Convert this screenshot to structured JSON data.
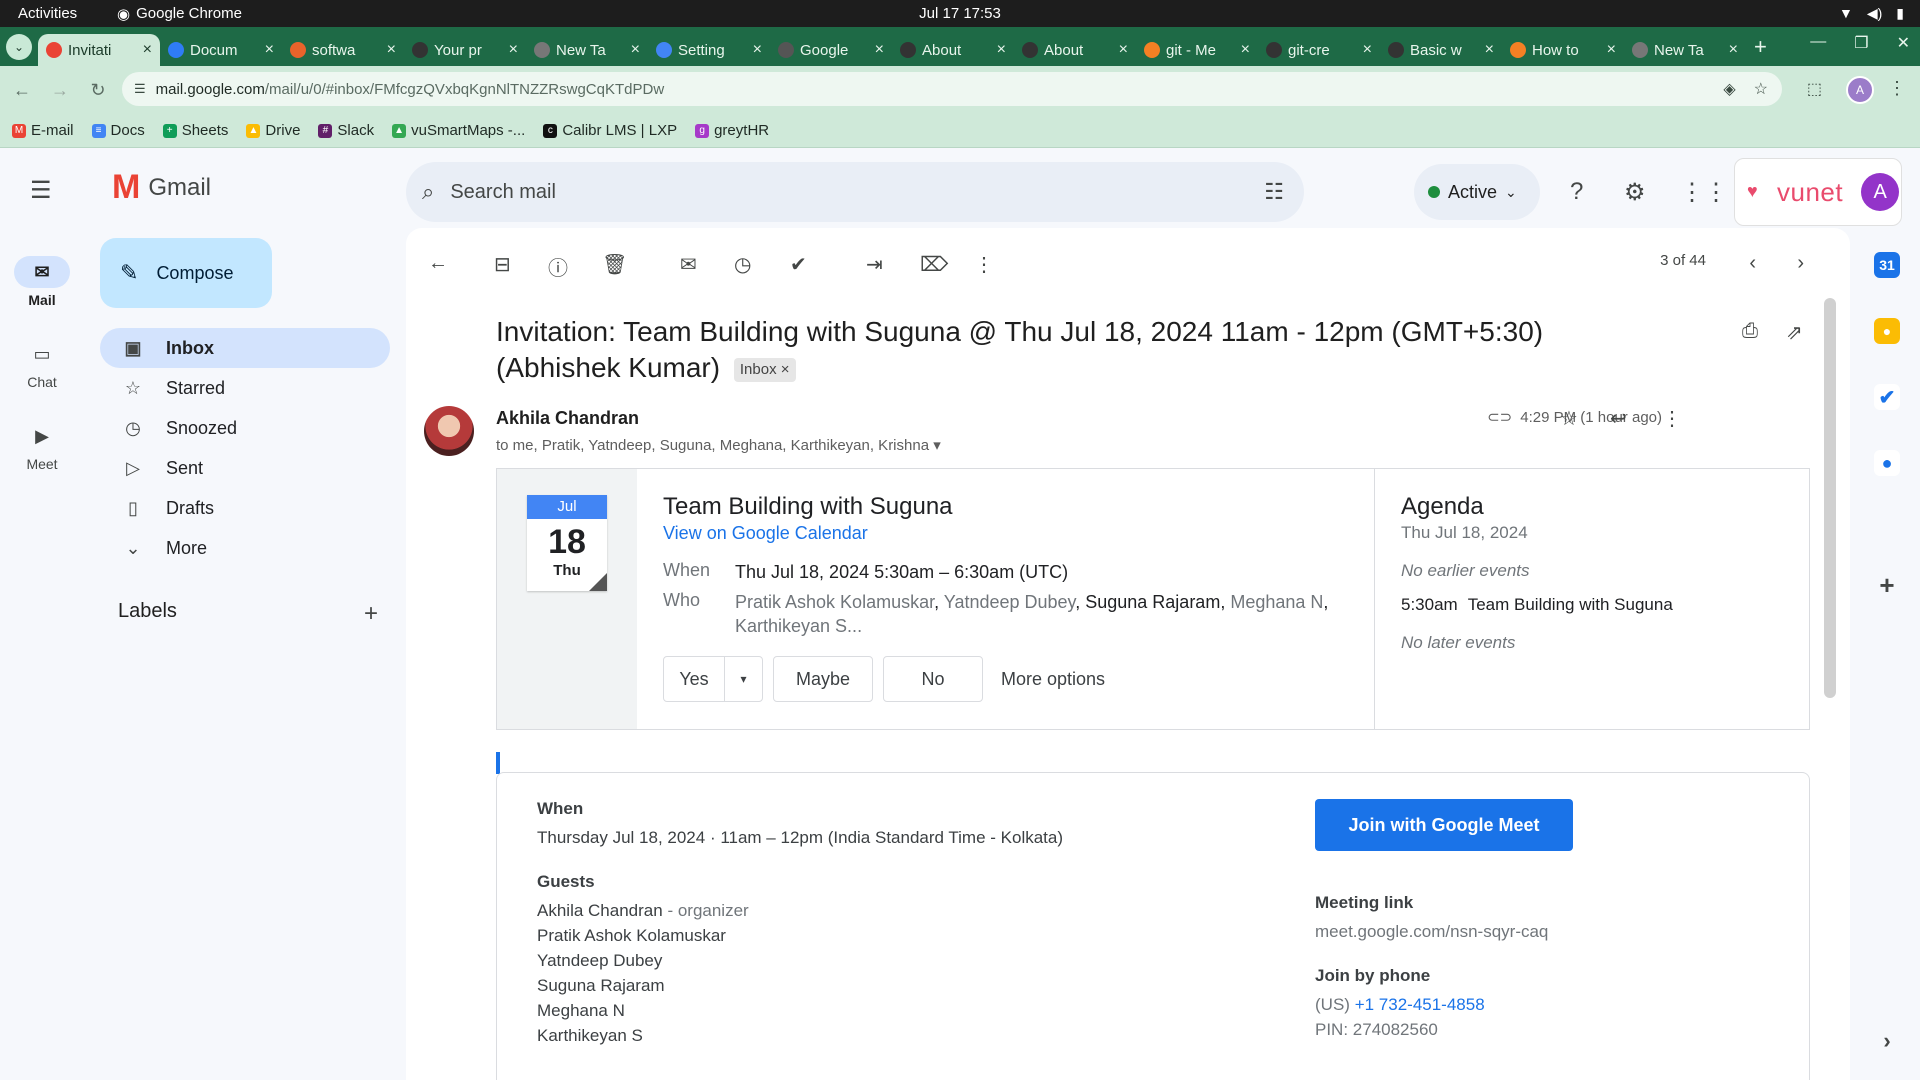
{
  "os": {
    "activities": "Activities",
    "app_name": "Google Chrome",
    "clock": "Jul 17  17:53"
  },
  "tabs": [
    {
      "title": "Invitati",
      "color": "#ea4335",
      "active": true
    },
    {
      "title": "Docum",
      "color": "#2f7cf6"
    },
    {
      "title": "softwa",
      "color": "#e8632b"
    },
    {
      "title": "Your pr",
      "color": "#333333"
    },
    {
      "title": "New Ta",
      "color": "#777777"
    },
    {
      "title": "Setting",
      "color": "#4285f4"
    },
    {
      "title": "Google",
      "color": "#555555"
    },
    {
      "title": "About",
      "color": "#333333"
    },
    {
      "title": "About",
      "color": "#333333"
    },
    {
      "title": "git - Me",
      "color": "#f48024"
    },
    {
      "title": "git-cre",
      "color": "#333333"
    },
    {
      "title": "Basic w",
      "color": "#333333"
    },
    {
      "title": "How to",
      "color": "#f48024"
    },
    {
      "title": "New Ta",
      "color": "#777777"
    }
  ],
  "omnibox": {
    "host": "mail.google.com",
    "path": "/mail/u/0/#inbox/FMfcgzQVxbqKgnNlTNZZRswgCqKTdPDw",
    "profile_initial": "A"
  },
  "bookmarks": [
    {
      "label": "E-mail",
      "color": "#ea4335",
      "glyph": "M"
    },
    {
      "label": "Docs",
      "color": "#4285f4",
      "glyph": "≡"
    },
    {
      "label": "Sheets",
      "color": "#0f9d58",
      "glyph": "+"
    },
    {
      "label": "Drive",
      "color": "#fbbc04",
      "glyph": "▲"
    },
    {
      "label": "Slack",
      "color": "#611f69",
      "glyph": "#"
    },
    {
      "label": "vuSmartMaps -...",
      "color": "#34a853",
      "glyph": "▲"
    },
    {
      "label": "Calibr LMS | LXP",
      "color": "#111111",
      "glyph": "c"
    },
    {
      "label": "greytHR",
      "color": "#a63ac9",
      "glyph": "g"
    }
  ],
  "gmail": {
    "logo_word": "Gmail",
    "compose": "Compose",
    "rail": [
      {
        "label": "Mail",
        "icon": "mail-icon",
        "glyph": "✉",
        "active": true
      },
      {
        "label": "Chat",
        "icon": "chat-icon",
        "glyph": "▭"
      },
      {
        "label": "Meet",
        "icon": "video-icon",
        "glyph": "▶"
      }
    ],
    "nav": [
      {
        "label": "Inbox",
        "icon": "inbox-icon",
        "glyph": "▣",
        "active": true
      },
      {
        "label": "Starred",
        "icon": "star-icon",
        "glyph": "☆"
      },
      {
        "label": "Snoozed",
        "icon": "clock-icon",
        "glyph": "◷"
      },
      {
        "label": "Sent",
        "icon": "send-icon",
        "glyph": "▷"
      },
      {
        "label": "Drafts",
        "icon": "draft-icon",
        "glyph": "▯"
      },
      {
        "label": "More",
        "icon": "chevron-down-icon",
        "glyph": "⌄"
      }
    ],
    "labels_heading": "Labels",
    "search_placeholder": "Search mail",
    "status": "Active",
    "brand": "vunet",
    "avatar_initial": "A"
  },
  "message": {
    "counter": "3 of 44",
    "subject": "Invitation: Team Building with Suguna @ Thu Jul 18, 2024 11am - 12pm (GMT+5:30) (Abhishek Kumar)",
    "inbox_tag": "Inbox ×",
    "sender": "Akhila Chandran",
    "recipients": "to me, Pratik, Yatndeep, Suguna, Meghana, Karthikeyan, Krishna",
    "time": "4:29 PM (1 hour ago)"
  },
  "invite": {
    "cal_month": "Jul",
    "cal_day": "18",
    "cal_dow": "Thu",
    "title": "Team Building with Suguna",
    "calendar_link": "View on Google Calendar",
    "when_label": "When",
    "when_value": "Thu Jul 18, 2024 5:30am – 6:30am (UTC)",
    "who_label": "Who",
    "who_1": "Pratik Ashok Kolamuskar",
    "who_2": "Yatndeep Dubey",
    "who_3": "Suguna Rajaram",
    "who_4": "Meghana N",
    "who_5": "Karthikeyan S...",
    "rsvp_yes": "Yes",
    "rsvp_maybe": "Maybe",
    "rsvp_no": "No",
    "rsvp_more": "More options",
    "agenda_title": "Agenda",
    "agenda_date": "Thu Jul 18, 2024",
    "agenda_earlier": "No earlier events",
    "agenda_time": "5:30am",
    "agenda_event": "Team Building with Suguna",
    "agenda_later": "No later events"
  },
  "details": {
    "when_heading": "When",
    "when_text": "Thursday Jul 18, 2024 · 11am – 12pm (India Standard Time - Kolkata)",
    "guests_heading": "Guests",
    "organizer": "Akhila Chandran",
    "organizer_role": "- organizer",
    "guests": [
      "Pratik Ashok Kolamuskar",
      "Yatndeep Dubey",
      "Suguna Rajaram",
      "Meghana N",
      "Karthikeyan S"
    ],
    "meet_button": "Join with Google Meet",
    "meeting_link_heading": "Meeting link",
    "meeting_link": "meet.google.com/nsn-sqyr-caq",
    "phone_heading": "Join by phone",
    "phone_prefix": "(US)",
    "phone_number": "+1 732-451-4858",
    "pin": "PIN: 274082560"
  }
}
